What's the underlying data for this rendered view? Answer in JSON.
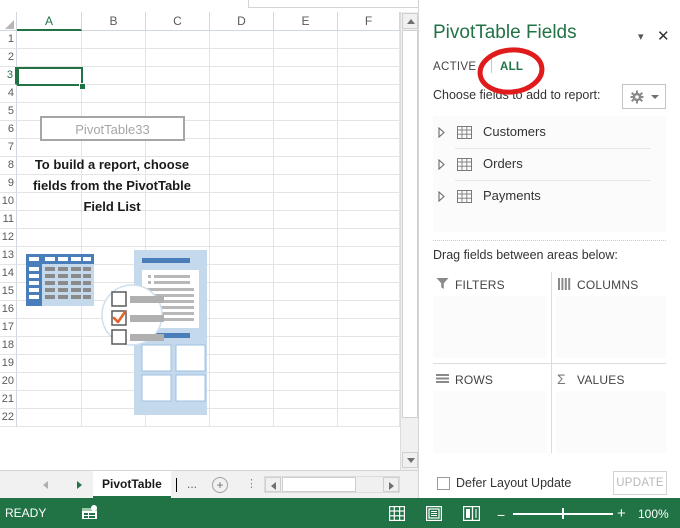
{
  "worksheet": {
    "columns": [
      "A",
      "B",
      "C",
      "D",
      "E",
      "F"
    ],
    "selected_column": "A",
    "rows": [
      "1",
      "2",
      "3",
      "4",
      "5",
      "6",
      "7",
      "8",
      "9",
      "10",
      "11",
      "12",
      "13",
      "14",
      "15",
      "16",
      "17",
      "18",
      "19",
      "20",
      "21",
      "22"
    ],
    "active_cell": "A3",
    "pivot_placeholder": {
      "name": "PivotTable33",
      "message_line1": "To build a report, choose",
      "message_line2": "fields from the PivotTable",
      "message_line3": "Field List"
    }
  },
  "sheet_tabs": {
    "prev_label": "previous-sheet",
    "next_label": "next-sheet",
    "active_tab": "PivotTable",
    "overflow_label": "...",
    "add_label": "+"
  },
  "status_bar": {
    "state": "READY",
    "zoom_level": "100%",
    "zoom_out": "−",
    "zoom_in": "+",
    "views": [
      "normal-view",
      "page-layout-view",
      "page-break-view"
    ]
  },
  "pane": {
    "title": "PivotTable Fields",
    "minimize_label": "▾",
    "close_label": "✕",
    "tabs": [
      {
        "label": "ACTIVE",
        "active": false
      },
      {
        "label": "ALL",
        "active": true
      }
    ],
    "choose_label": "Choose fields to add to report:",
    "tools_label": "tools",
    "fields": [
      {
        "label": "Customers"
      },
      {
        "label": "Orders"
      },
      {
        "label": "Payments"
      }
    ],
    "drag_label": "Drag fields between areas below:",
    "zones": [
      {
        "label": "FILTERS",
        "icon": "filter-icon"
      },
      {
        "label": "COLUMNS",
        "icon": "columns-icon"
      },
      {
        "label": "ROWS",
        "icon": "rows-icon"
      },
      {
        "label": "VALUES",
        "icon": "sigma-icon"
      }
    ],
    "defer_label": "Defer Layout Update",
    "update_label": "UPDATE"
  },
  "colors": {
    "excel_green": "#217346",
    "annotation_red": "#e01b1b",
    "illustration_blue": "#4a7ebb",
    "illustration_light": "#c5d9ed",
    "accent_orange": "#e2622a"
  }
}
